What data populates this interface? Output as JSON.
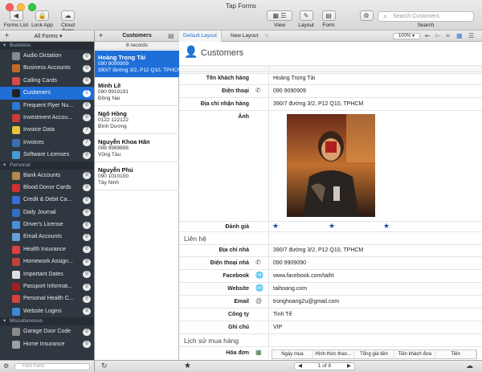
{
  "window": {
    "title": "Tap Forms"
  },
  "toolbar": {
    "forms_list": "Forms List",
    "lock_app": "Lock App",
    "cloud_sync": "Cloud Sync",
    "view": "View",
    "layout": "Layout",
    "form": "Form",
    "search_placeholder": "Search Customers",
    "search_label": "Search"
  },
  "sidebar": {
    "add": "+",
    "filter": "All Forms",
    "find_placeholder": "Find Form",
    "groups": [
      {
        "name": "Business",
        "items": [
          {
            "label": "Audio Dictation",
            "count": "0",
            "color": "#8a8a8a"
          },
          {
            "label": "Business Accounts",
            "count": "0",
            "color": "#c06a2a"
          },
          {
            "label": "Calling Cards",
            "count": "0",
            "color": "#d84a4a"
          },
          {
            "label": "Customers",
            "count": "5",
            "color": "#222222",
            "selected": true
          },
          {
            "label": "Frequent Flyer Nu...",
            "count": "0",
            "color": "#2a79d8"
          },
          {
            "label": "Investment Accou...",
            "count": "0",
            "color": "#c93a3a"
          },
          {
            "label": "Invoice Data",
            "count": "7",
            "color": "#e6c33a"
          },
          {
            "label": "Invoices",
            "count": "7",
            "color": "#3a6fb0"
          },
          {
            "label": "Software Licenses",
            "count": "0",
            "color": "#4a9ad8"
          }
        ]
      },
      {
        "name": "Personal",
        "items": [
          {
            "label": "Bank Accounts",
            "count": "0",
            "color": "#b58a4a"
          },
          {
            "label": "Blood Donor Cards",
            "count": "0",
            "color": "#d03030"
          },
          {
            "label": "Credit & Debit Ca...",
            "count": "0",
            "color": "#3a6fd8"
          },
          {
            "label": "Daily Journal",
            "count": "0",
            "color": "#2f6fc0"
          },
          {
            "label": "Driver's License",
            "count": "0",
            "color": "#4a8fd8"
          },
          {
            "label": "Email Accounts",
            "count": "0",
            "color": "#6a9fd8"
          },
          {
            "label": "Health Insurance",
            "count": "0",
            "color": "#e04040"
          },
          {
            "label": "Homework Assign...",
            "count": "0",
            "color": "#c04040"
          },
          {
            "label": "Important Dates",
            "count": "0",
            "color": "#e0e0e0"
          },
          {
            "label": "Passport Informat...",
            "count": "0",
            "color": "#a02020"
          },
          {
            "label": "Personal Health C...",
            "count": "0",
            "color": "#d84040"
          },
          {
            "label": "Website Logins",
            "count": "0",
            "color": "#3a8ad8"
          }
        ]
      },
      {
        "name": "Miscellaneous",
        "items": [
          {
            "label": "Garage Door Code",
            "count": "0",
            "color": "#8a8a8a"
          },
          {
            "label": "Home Insurance",
            "count": "0",
            "color": "#a0a0a0"
          }
        ]
      }
    ]
  },
  "records": {
    "title": "Customers",
    "count": "8 records",
    "items": [
      {
        "name": "Hoàng Trọng Tài",
        "line1": "090 9090909",
        "line2": "390/7 đường 3/2, P12 Q10, TPHCM",
        "selected": true
      },
      {
        "name": "Minh Lê",
        "line1": "090 9919191",
        "line2": "Đồng Nai"
      },
      {
        "name": "Ngô Hồng",
        "line1": "0122 122122",
        "line2": "Bình Dương"
      },
      {
        "name": "Nguyễn Khoa Hân",
        "line1": "098 9989898",
        "line2": "Vũng Tàu"
      },
      {
        "name": "Nguyễn Phú",
        "line1": "090 1010100",
        "line2": "Tây Ninh"
      }
    ]
  },
  "layout_tabs": [
    "Default Layout",
    "New Layout"
  ],
  "form": {
    "title": "Customers",
    "zoom": "100%",
    "fields": {
      "ten_label": "Tên khách hàng",
      "ten_value": "Hoàng Trọng Tài",
      "dienthoai_label": "Điện thoại",
      "dienthoai_value": "090 9090909",
      "diachi_label": "Địa chỉ nhận hàng",
      "diachi_value": "390/7 đường 3/2, P12 Q10, TPHCM",
      "anh_label": "Ảnh",
      "danhgia_label": "Đánh giá",
      "rating": 3,
      "lienhe_section": "Liên hệ",
      "diachinha_label": "Địa chỉ nhà",
      "diachinha_value": "390/7 đường 3/2, P12 Q10, TPHCM",
      "dtnha_label": "Điện thoại nhà",
      "dtnha_value": "090 9909090",
      "facebook_label": "Facebook",
      "facebook_value": "www.facebook.com/taiht",
      "website_label": "Website",
      "website_value": "taihoang.com",
      "email_label": "Email",
      "email_value": "tronghoang2u@gmail.com",
      "congty_label": "Công ty",
      "congty_value": "Tinh Tế",
      "ghichu_label": "Ghi chú",
      "ghichu_value": "VIP",
      "lichsu_section": "Lịch sử mua hàng",
      "hoadon_label": "Hóa đơn"
    },
    "subtable_columns": [
      "Ngày mua",
      "Hình thức than...",
      "Tổng giá tiền",
      "Tiền khách đưa",
      "Tiền"
    ],
    "pager": "1 of 8"
  }
}
